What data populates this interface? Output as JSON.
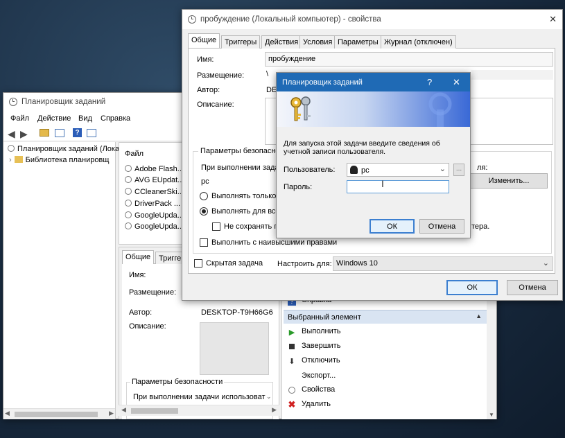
{
  "main_window": {
    "title": "Планировщик заданий",
    "menu": [
      "Файл",
      "Действие",
      "Вид",
      "Справка"
    ],
    "tree": {
      "root": "Планировщик заданий (Лока",
      "library": "Библиотека планировщ"
    },
    "list_header": "Файл",
    "tasks": [
      "Adobe Flash...",
      "AVG EUpdat...",
      "CCleanerSki...",
      "DriverPack ...",
      "GoogleUpda...",
      "GoogleUpda..."
    ],
    "bottom_tabs": [
      "Общие",
      "Тригге"
    ],
    "details": {
      "name_label": "Имя:",
      "location_label": "Размещение:",
      "author_label": "Автор:",
      "author_value": "DESKTOP-T9H66G6",
      "description_label": "Описание:",
      "security_label": "Параметры безопасности",
      "run_as_label": "При выполнении задачи использоват"
    },
    "actions": {
      "help_item": "Справка",
      "selected_header": "Выбранный элемент",
      "items": [
        "Выполнить",
        "Завершить",
        "Отключить",
        "Экспорт...",
        "Свойства",
        "Удалить"
      ]
    }
  },
  "props_window": {
    "title": "пробуждение (Локальный компьютер) - свойства",
    "tabs": [
      "Общие",
      "Триггеры",
      "Действия",
      "Условия",
      "Параметры",
      "Журнал (отключен)"
    ],
    "name_label": "Имя:",
    "name_value": "пробуждение",
    "location_label": "Размещение:",
    "location_value": "\\",
    "author_label": "Автор:",
    "author_value": "DE",
    "description_label": "Описание:",
    "security_group": "Параметры безопасно",
    "run_as_label": "При выполнении зада",
    "run_as_user": "pc",
    "run_as_right": "ля:",
    "change_button": "Изменить...",
    "radio_logged_on": "Выполнять только д",
    "radio_any": "Выполнять для всех",
    "dont_store_password": "Не сохранять па",
    "right_fragment": "тера.",
    "highest_privileges": "Выполнить с наивысшими правами",
    "hidden_task": "Скрытая задача",
    "configure_for_label": "Настроить для:",
    "configure_for_value": "Windows 10",
    "ok_button": "ОК",
    "cancel_button": "Отмена",
    "close_icon": "✕"
  },
  "auth_dialog": {
    "title": "Планировщик заданий",
    "help": "?",
    "close": "✕",
    "message": "Для запуска этой задачи введите сведения об учетной записи пользователя.",
    "user_label": "Пользователь:",
    "user_value": "pc",
    "browse": "...",
    "password_label": "Пароль:",
    "password_value": "",
    "ok_button": "ОК",
    "cancel_button": "Отмена"
  }
}
